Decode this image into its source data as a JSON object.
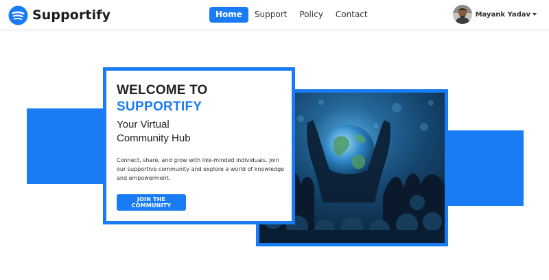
{
  "brand": {
    "name": "Supportify",
    "logo_icon": "spotify-like-logo-icon",
    "color": "#1a7cf5"
  },
  "nav": {
    "items": [
      {
        "label": "Home",
        "active": true
      },
      {
        "label": "Support",
        "active": false
      },
      {
        "label": "Policy",
        "active": false
      },
      {
        "label": "Contact",
        "active": false
      }
    ]
  },
  "user": {
    "name": "Mayank Yadav",
    "dropdown_icon": "caret-down-icon"
  },
  "hero": {
    "welcome": "WELCOME TO",
    "brand": "SUPPORTIFY",
    "tagline_line1": "Your Virtual",
    "tagline_line2": "Community Hub",
    "description": "Connect, share, and grow with like-minded individuals. Join our supportive community and explore a world of knowledge and empowerment.",
    "cta_label": "JOIN THE COMMUNITY",
    "image_subject": "hands holding glowing globe above crowd"
  },
  "colors": {
    "accent": "#1a7cf5",
    "text": "#222222"
  }
}
